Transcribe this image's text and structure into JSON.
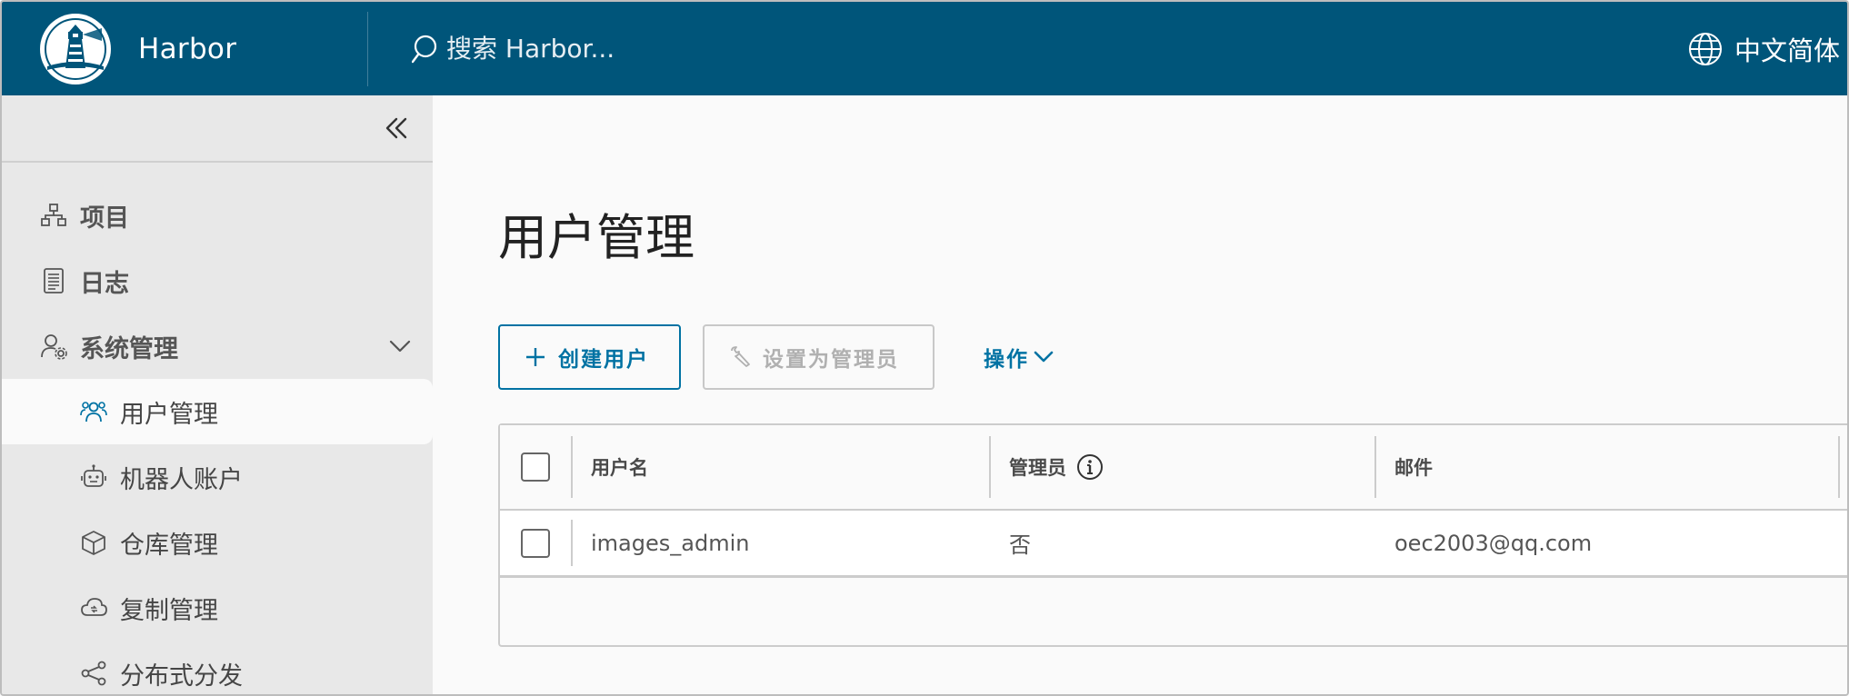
{
  "header": {
    "brand_name": "Harbor",
    "search_placeholder": "搜索 Harbor...",
    "language": "中文简体",
    "bg_color": "#00557a"
  },
  "sidebar": {
    "items": [
      {
        "label": "项目",
        "icon": "project-icon"
      },
      {
        "label": "日志",
        "icon": "log-icon"
      },
      {
        "label": "系统管理",
        "icon": "admin-gear-icon"
      }
    ],
    "sub_items": [
      {
        "label": "用户管理",
        "icon": "users-icon",
        "active": true
      },
      {
        "label": "机器人账户",
        "icon": "robot-icon"
      },
      {
        "label": "仓库管理",
        "icon": "box-icon"
      },
      {
        "label": "复制管理",
        "icon": "cloud-sync-icon"
      },
      {
        "label": "分布式分发",
        "icon": "share-icon"
      }
    ]
  },
  "main": {
    "title": "用户管理",
    "toolbar": {
      "create_user": "创建用户",
      "set_admin": "设置为管理员",
      "actions": "操作"
    },
    "table": {
      "columns": [
        "用户名",
        "管理员",
        "邮件"
      ],
      "rows": [
        {
          "username": "images_admin",
          "admin": "否",
          "email": "oec2003@qq.com"
        }
      ]
    }
  },
  "colors": {
    "accent": "#0072a3",
    "header": "#00557a",
    "sidebar": "#e8e8e8"
  }
}
